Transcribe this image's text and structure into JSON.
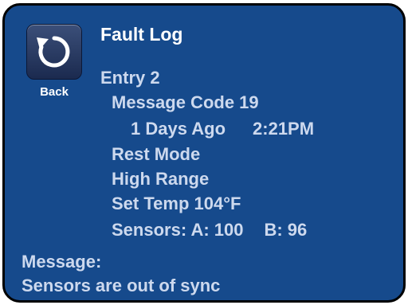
{
  "header": {
    "title": "Fault Log",
    "back_label": "Back"
  },
  "icons": {
    "back": "back-arrow-icon"
  },
  "entry": {
    "label": "Entry 2",
    "message_code": "Message Code 19",
    "days_ago": "1 Days Ago",
    "time": "2:21PM",
    "mode": "Rest Mode",
    "range": "High Range",
    "set_temp": "Set Temp 104°F",
    "sensors_a": "Sensors: A: 100",
    "sensors_b": "B: 96"
  },
  "message": {
    "label": "Message:",
    "text": "Sensors are out of sync"
  },
  "colors": {
    "background": "#164a8c",
    "text": "#cdd9ee",
    "title": "#ffffff"
  }
}
